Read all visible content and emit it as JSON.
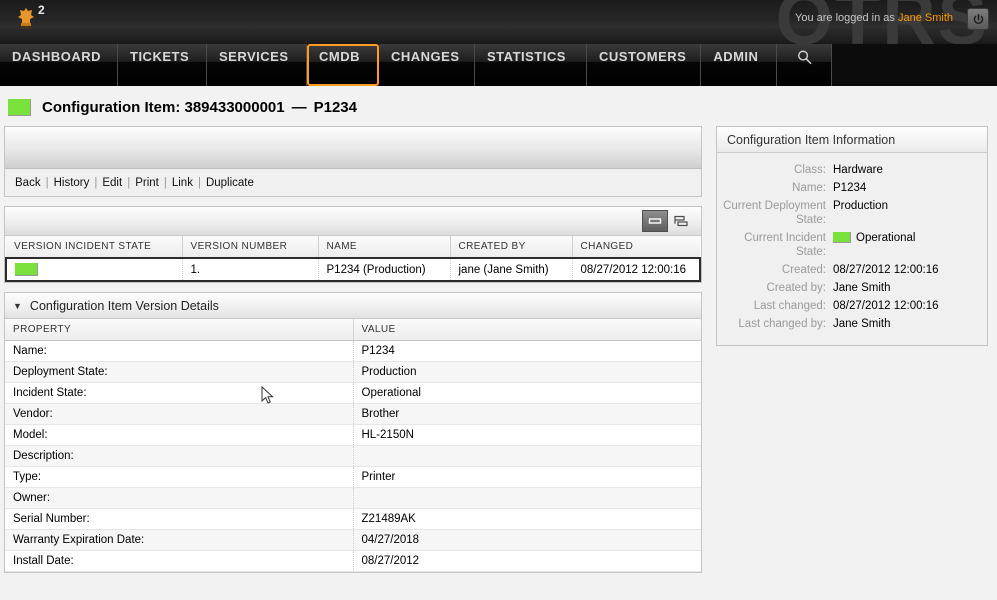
{
  "header": {
    "wordmark": "OTRS",
    "logo_badge": "2",
    "logo_icon": "chess-piece-icon",
    "login_prefix": "You are logged in as",
    "login_user": "Jane Smith",
    "logout_icon": "power-icon"
  },
  "nav": {
    "items": [
      {
        "label": "DASHBOARD",
        "selected": false
      },
      {
        "label": "TICKETS",
        "selected": false
      },
      {
        "label": "SERVICES",
        "selected": false
      },
      {
        "label": "CMDB",
        "selected": true
      },
      {
        "label": "CHANGES",
        "selected": false
      },
      {
        "label": "STATISTICS",
        "selected": false
      },
      {
        "label": "CUSTOMERS",
        "selected": false
      },
      {
        "label": "ADMIN",
        "selected": false
      }
    ],
    "search_icon": "search-icon"
  },
  "page": {
    "title_prefix": "Configuration Item:",
    "title_number": "389433000001",
    "title_dash": "—",
    "title_name": "P1234",
    "state_color": "#7ae03c"
  },
  "actions": {
    "links": [
      "Back",
      "History",
      "Edit",
      "Print",
      "Link",
      "Duplicate"
    ],
    "separator": "|"
  },
  "versions": {
    "toolbar": {
      "collapse_icon": "minimize-icon",
      "expand_icon": "columns-icon"
    },
    "columns": [
      "VERSION INCIDENT STATE",
      "VERSION NUMBER",
      "NAME",
      "CREATED BY",
      "CHANGED"
    ],
    "rows": [
      {
        "incident_state": "operational-green-chip",
        "version_number": "1.",
        "name": "P1234 (Production)",
        "created_by": "jane (Jane Smith)",
        "changed": "08/27/2012 12:00:16",
        "selected": true
      }
    ]
  },
  "details": {
    "header": "Configuration Item Version Details",
    "caret": "▼",
    "columns": [
      "PROPERTY",
      "VALUE"
    ],
    "rows": [
      {
        "property": "Name:",
        "value": "P1234"
      },
      {
        "property": "Deployment State:",
        "value": "Production"
      },
      {
        "property": "Incident State:",
        "value": "Operational"
      },
      {
        "property": "Vendor:",
        "value": "Brother"
      },
      {
        "property": "Model:",
        "value": "HL-2150N"
      },
      {
        "property": "Description:",
        "value": ""
      },
      {
        "property": "Type:",
        "value": "Printer"
      },
      {
        "property": "Owner:",
        "value": ""
      },
      {
        "property": "Serial Number:",
        "value": "Z21489AK"
      },
      {
        "property": "Warranty Expiration Date:",
        "value": "04/27/2018"
      },
      {
        "property": "Install Date:",
        "value": "08/27/2012"
      }
    ]
  },
  "sidebar": {
    "title": "Configuration Item Information",
    "rows": [
      {
        "label": "Class:",
        "value": "Hardware",
        "chip": false
      },
      {
        "label": "Name:",
        "value": "P1234",
        "chip": false
      },
      {
        "label": "Current Deployment State:",
        "value": "Production",
        "chip": false
      },
      {
        "label": "Current Incident State:",
        "value": "Operational",
        "chip": true
      },
      {
        "label": "Created:",
        "value": "08/27/2012 12:00:16",
        "chip": false
      },
      {
        "label": "Created by:",
        "value": "Jane Smith",
        "chip": false
      },
      {
        "label": "Last changed:",
        "value": "08/27/2012 12:00:16",
        "chip": false
      },
      {
        "label": "Last changed by:",
        "value": "Jane Smith",
        "chip": false
      }
    ]
  }
}
